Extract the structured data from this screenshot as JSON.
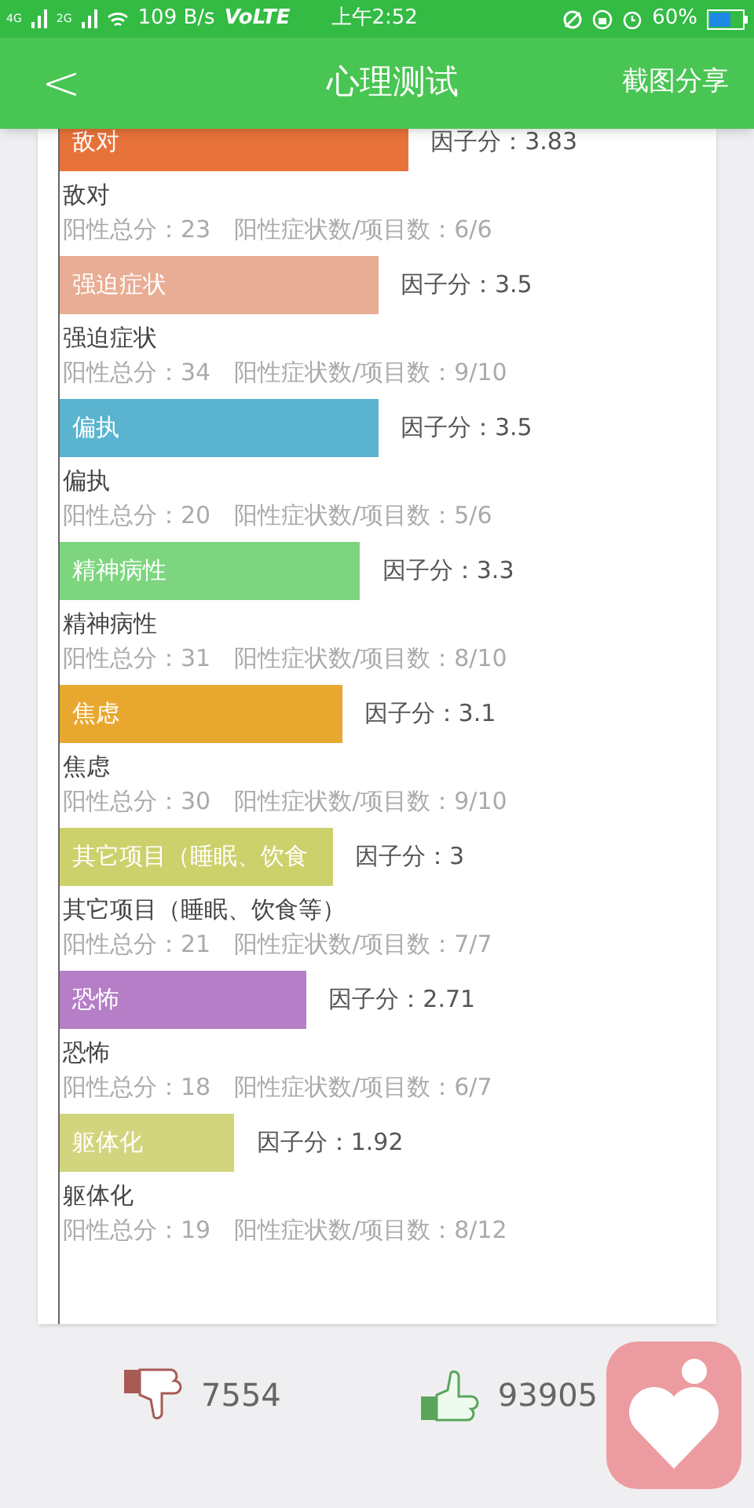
{
  "status_bar": {
    "sim_1": "4G",
    "sim_2": "2G",
    "speed": "109 B/s",
    "network": "VoLTE",
    "time": "上午2:52",
    "battery": "60%"
  },
  "header": {
    "back": "<",
    "title": "心理测试",
    "action": "截图分享"
  },
  "factors": [
    {
      "bar_label": "敌对",
      "score": "因子分：3.83",
      "color": "#e8733a",
      "name": "敌对",
      "stats": "阳性总分：23　阳性症状数/项目数：6/6"
    },
    {
      "bar_label": "强迫症状",
      "score": "因子分：3.5",
      "color": "#e8ad94",
      "name": "强迫症状",
      "stats": "阳性总分：34　阳性症状数/项目数：9/10"
    },
    {
      "bar_label": "偏执",
      "score": "因子分：3.5",
      "color": "#5ab4d0",
      "name": "偏执",
      "stats": "阳性总分：20　阳性症状数/项目数：5/6"
    },
    {
      "bar_label": "精神病性",
      "score": "因子分：3.3",
      "color": "#7dd67f",
      "name": "精神病性",
      "stats": "阳性总分：31　阳性症状数/项目数：8/10"
    },
    {
      "bar_label": "焦虑",
      "score": "因子分：3.1",
      "color": "#e8a830",
      "name": "焦虑",
      "stats": "阳性总分：30　阳性症状数/项目数：9/10"
    },
    {
      "bar_label": "其它项目（睡眠、饮食",
      "score": "因子分：3",
      "color": "#cdd16c",
      "name": "其它项目（睡眠、饮食等）",
      "stats": "阳性总分：21　阳性症状数/项目数：7/7"
    },
    {
      "bar_label": "恐怖",
      "score": "因子分：2.71",
      "color": "#b57ec6",
      "name": "恐怖",
      "stats": "阳性总分：18　阳性症状数/项目数：6/7"
    },
    {
      "bar_label": "躯体化",
      "score": "因子分：1.92",
      "color": "#d3d57e",
      "name": "躯体化",
      "stats": "阳性总分：19　阳性症状数/项目数：8/12"
    }
  ],
  "votes": {
    "dislikes": "7554",
    "likes": "93905"
  }
}
